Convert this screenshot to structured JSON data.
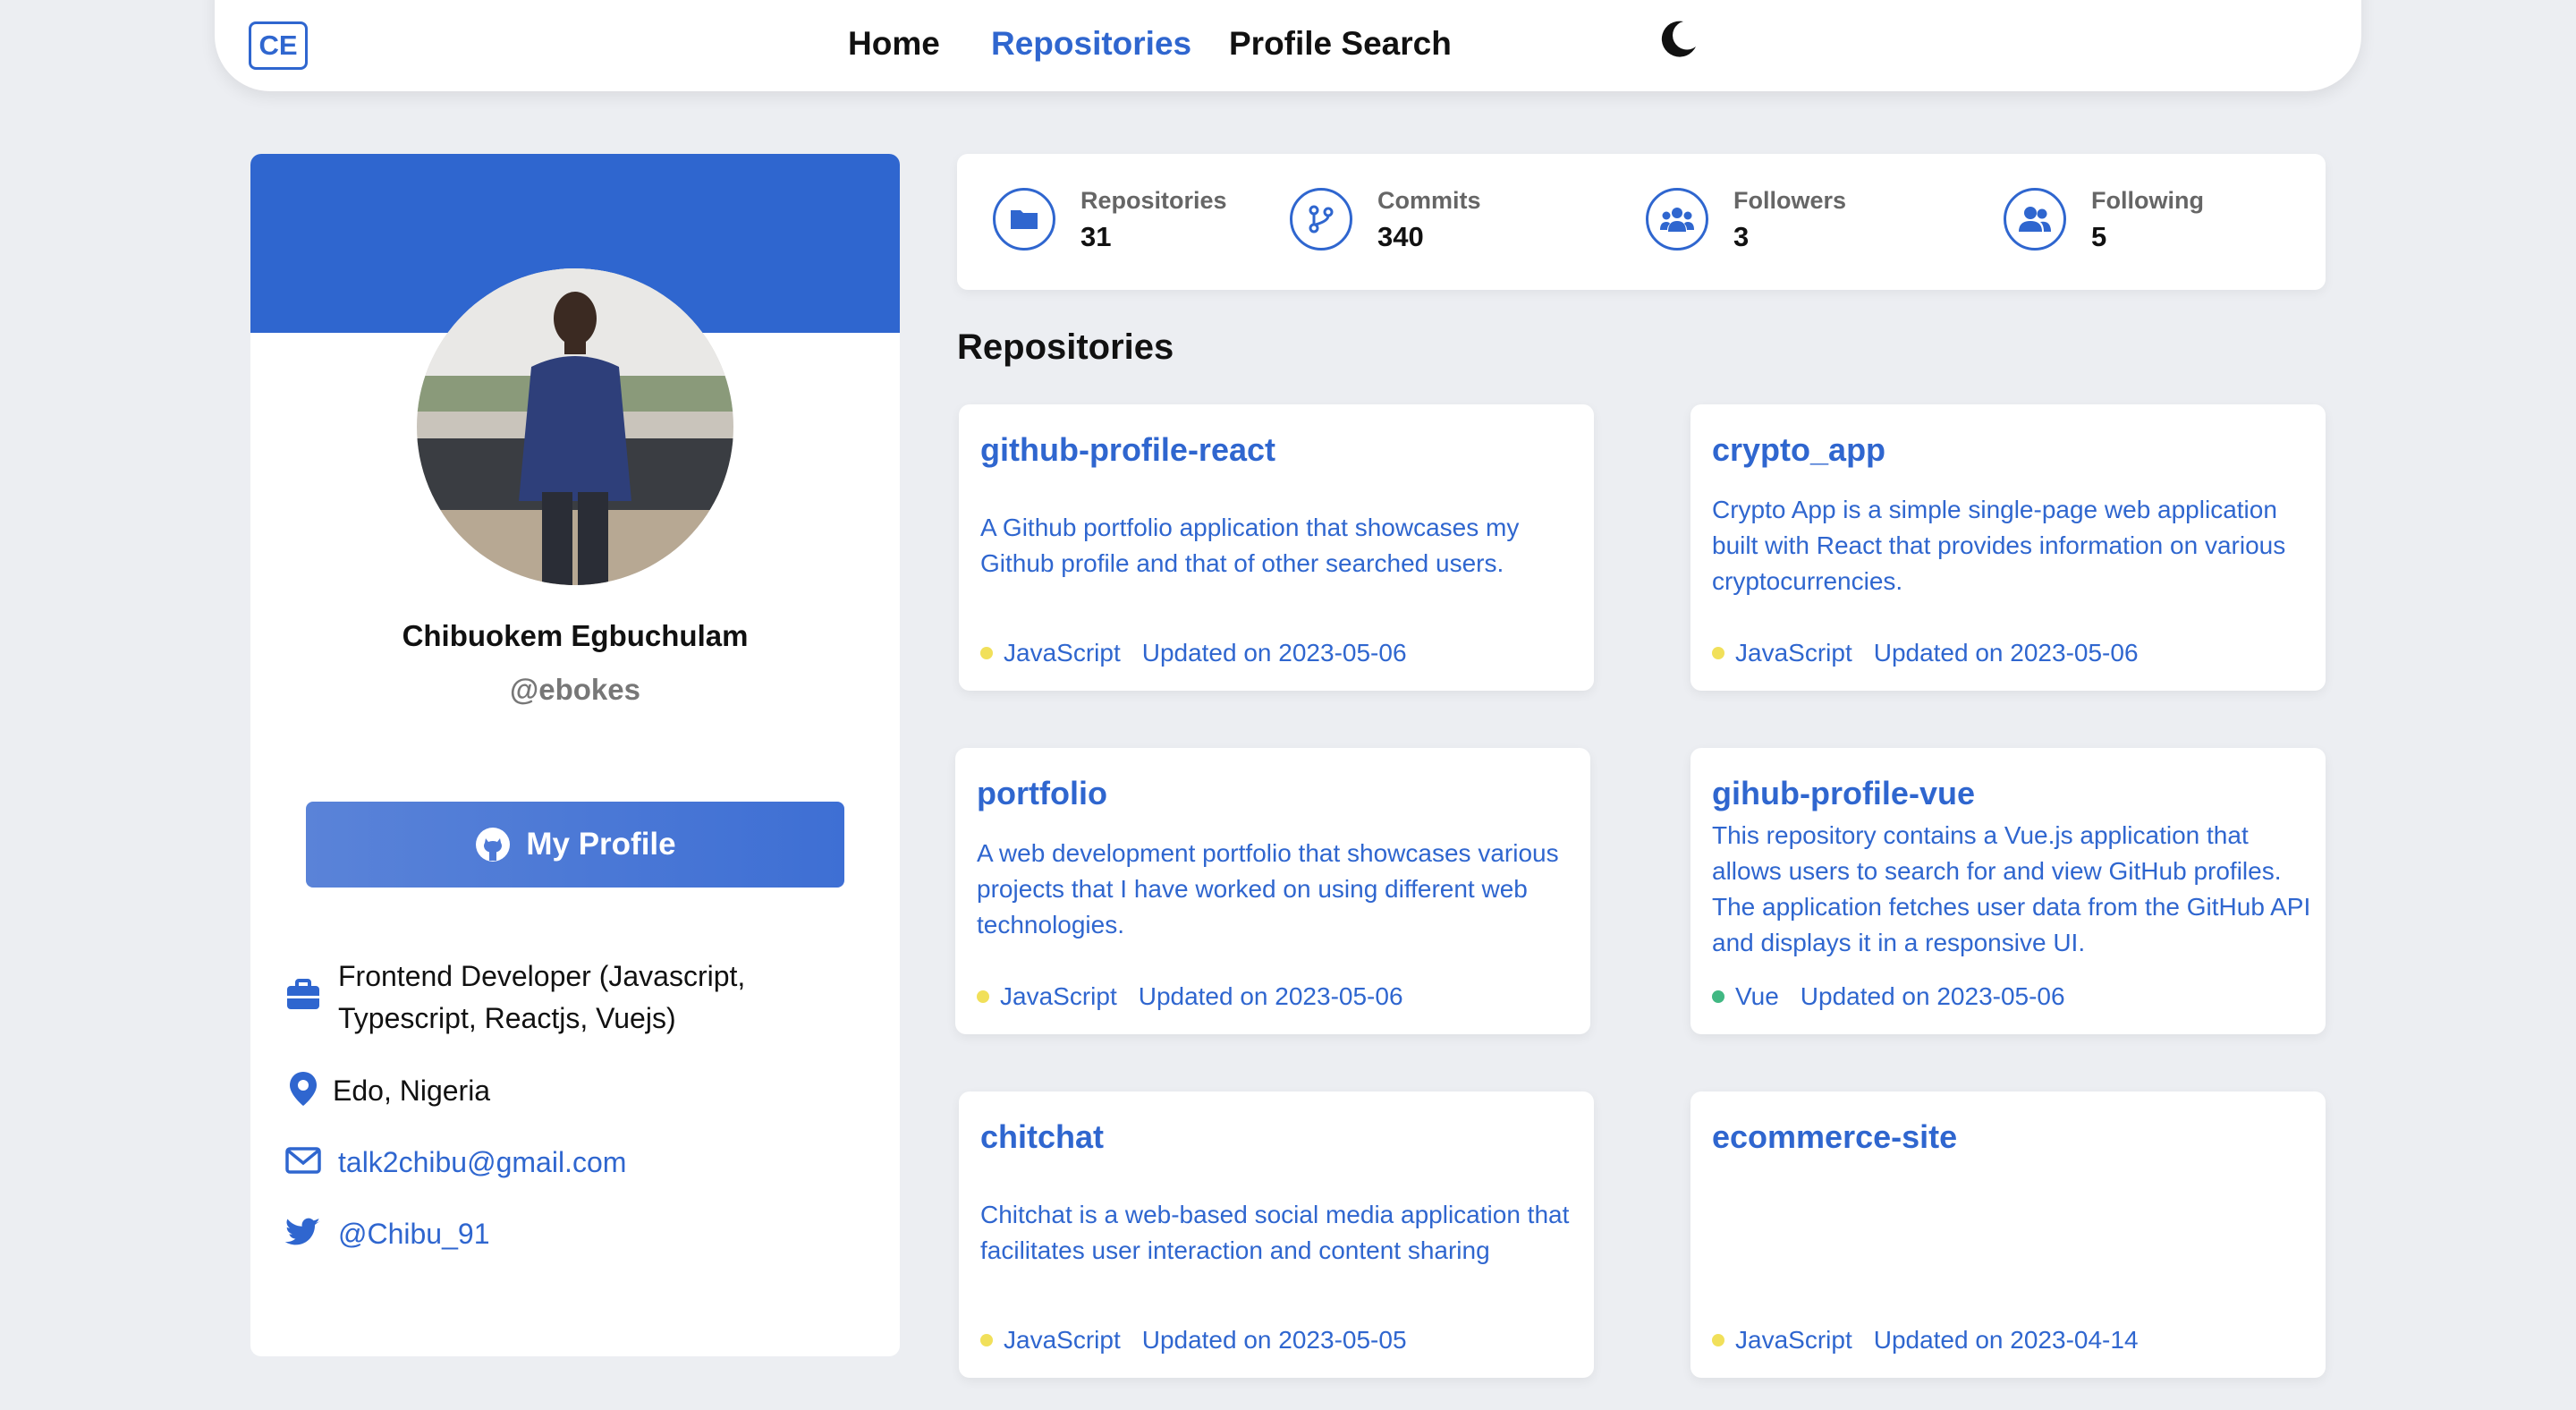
{
  "nav": {
    "logo": "CE",
    "links": [
      "Home",
      "Repositories",
      "Profile Search"
    ]
  },
  "profile": {
    "name": "Chibuokem Egbuchulam",
    "handle": "@ebokes",
    "button_label": "My Profile",
    "bio": "Frontend Developer (Javascript, Typescript, Reactjs, Vuejs)",
    "location": "Edo, Nigeria",
    "email": "talk2chibu@gmail.com",
    "twitter": "@Chibu_91"
  },
  "stats": [
    {
      "label": "Repositories",
      "value": "31"
    },
    {
      "label": "Commits",
      "value": "340"
    },
    {
      "label": "Followers",
      "value": "3"
    },
    {
      "label": "Following",
      "value": "5"
    }
  ],
  "section_title": "Repositories",
  "repos": [
    {
      "name": "github-profile-react",
      "description": "A Github portfolio application that showcases my Github profile and that of other searched users.",
      "language": "JavaScript",
      "updated": "Updated on 2023-05-06"
    },
    {
      "name": "crypto_app",
      "description": "Crypto App is a simple single-page web application built with React that provides information on various cryptocurrencies.",
      "language": "JavaScript",
      "updated": "Updated on 2023-05-06"
    },
    {
      "name": "portfolio",
      "description": "A web development portfolio that showcases various projects that I have worked on using different web technologies.",
      "language": "JavaScript",
      "updated": "Updated on 2023-05-06"
    },
    {
      "name": "gihub-profile-vue",
      "description": "This repository contains a Vue.js application that allows users to search for and view GitHub profiles. The application fetches user data from the GitHub API and displays it in a responsive UI.",
      "language": "Vue",
      "updated": "Updated on 2023-05-06"
    },
    {
      "name": "chitchat",
      "description": "Chitchat is a web-based social media application that facilitates user interaction and content sharing",
      "language": "JavaScript",
      "updated": "Updated on 2023-05-05"
    },
    {
      "name": "ecommerce-site",
      "description": "",
      "language": "JavaScript",
      "updated": "Updated on 2023-04-14"
    }
  ],
  "colors": {
    "accent": "#2f66cf",
    "javascript_dot": "#f1e05a",
    "vue_dot": "#41b883"
  },
  "icons": {
    "theme": "moon-icon",
    "github": "github-icon",
    "bio": "briefcase-icon",
    "location": "location-pin-icon",
    "email": "envelope-icon",
    "twitter": "twitter-icon",
    "repositories": "folder-icon",
    "commits": "branch-icon",
    "followers": "users-icon",
    "following": "user-group-icon"
  }
}
